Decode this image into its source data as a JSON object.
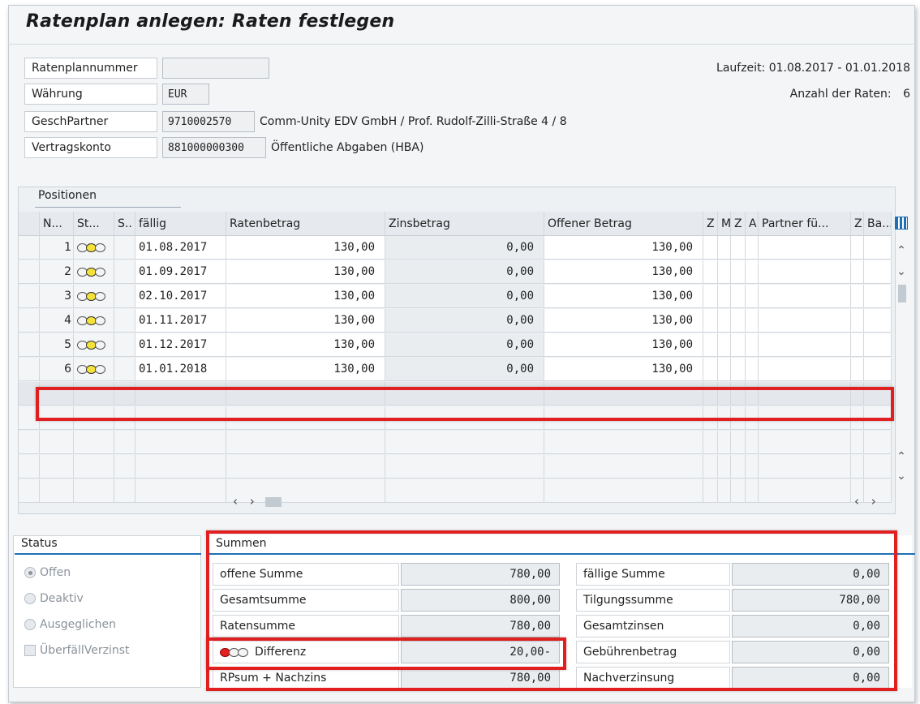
{
  "title": "Ratenplan anlegen: Raten festlegen",
  "header": {
    "ratenplannummer_label": "Ratenplannummer",
    "ratenplannummer_value": "",
    "waehrung_label": "Währung",
    "waehrung_value": "EUR",
    "geschpartner_label": "GeschPartner",
    "geschpartner_value": "9710002570",
    "geschpartner_text": "Comm-Unity EDV GmbH / Prof. Rudolf-Zilli-Straße 4 / 8",
    "vertragskonto_label": "Vertragskonto",
    "vertragskonto_value": "881000000300",
    "vertragskonto_text": "Öffentliche Abgaben (HBA)",
    "laufzeit": "Laufzeit: 01.08.2017 - 01.01.2018",
    "anzahl_label": "Anzahl der Raten:",
    "anzahl_value": "6"
  },
  "positions": {
    "title": "Positionen",
    "columns": [
      "N...",
      "St...",
      "S..",
      "fällig",
      "Ratenbetrag",
      "Zinsbetrag",
      "Offener Betrag",
      "Z",
      "M",
      "Z",
      "A",
      "Partner fü...",
      "Z",
      "Ba..."
    ],
    "rows": [
      {
        "nr": "1",
        "faellig": "01.08.2017",
        "raten": "130,00",
        "zins": "0,00",
        "offen": "130,00"
      },
      {
        "nr": "2",
        "faellig": "01.09.2017",
        "raten": "130,00",
        "zins": "0,00",
        "offen": "130,00"
      },
      {
        "nr": "3",
        "faellig": "02.10.2017",
        "raten": "130,00",
        "zins": "0,00",
        "offen": "130,00"
      },
      {
        "nr": "4",
        "faellig": "01.11.2017",
        "raten": "130,00",
        "zins": "0,00",
        "offen": "130,00"
      },
      {
        "nr": "5",
        "faellig": "01.12.2017",
        "raten": "130,00",
        "zins": "0,00",
        "offen": "130,00"
      },
      {
        "nr": "6",
        "faellig": "01.01.2018",
        "raten": "130,00",
        "zins": "0,00",
        "offen": "130,00"
      }
    ],
    "status_light": "yellow"
  },
  "status_panel": {
    "title": "Status",
    "options": [
      "Offen",
      "Deaktiv",
      "Ausgeglichen"
    ],
    "selected": "Offen",
    "checkbox": "ÜberfällVerzinst"
  },
  "summen": {
    "title": "Summen",
    "offene_summe_label": "offene Summe",
    "offene_summe": "780,00",
    "gesamtsumme_label": "Gesamtsumme",
    "gesamtsumme": "800,00",
    "ratensumme_label": "Ratensumme",
    "ratensumme": "780,00",
    "differenz_label": "Differenz",
    "differenz": "20,00-",
    "rpsum_label": "RPsum + Nachzins",
    "rpsum": "780,00",
    "faellige_summe_label": "fällige Summe",
    "faellige_summe": "0,00",
    "tilgungssumme_label": "Tilgungssumme",
    "tilgungssumme": "780,00",
    "gesamtzinsen_label": "Gesamtzinsen",
    "gesamtzinsen": "0,00",
    "gebuehren_label": "Gebührenbetrag",
    "gebuehren": "0,00",
    "nachverzinsung_label": "Nachverzinsung",
    "nachverzinsung": "0,00"
  },
  "colors": {
    "highlight": "#e02020",
    "accent": "#1f6fb5",
    "light_yellow": "#f4e23a",
    "light_red": "#e32020"
  }
}
